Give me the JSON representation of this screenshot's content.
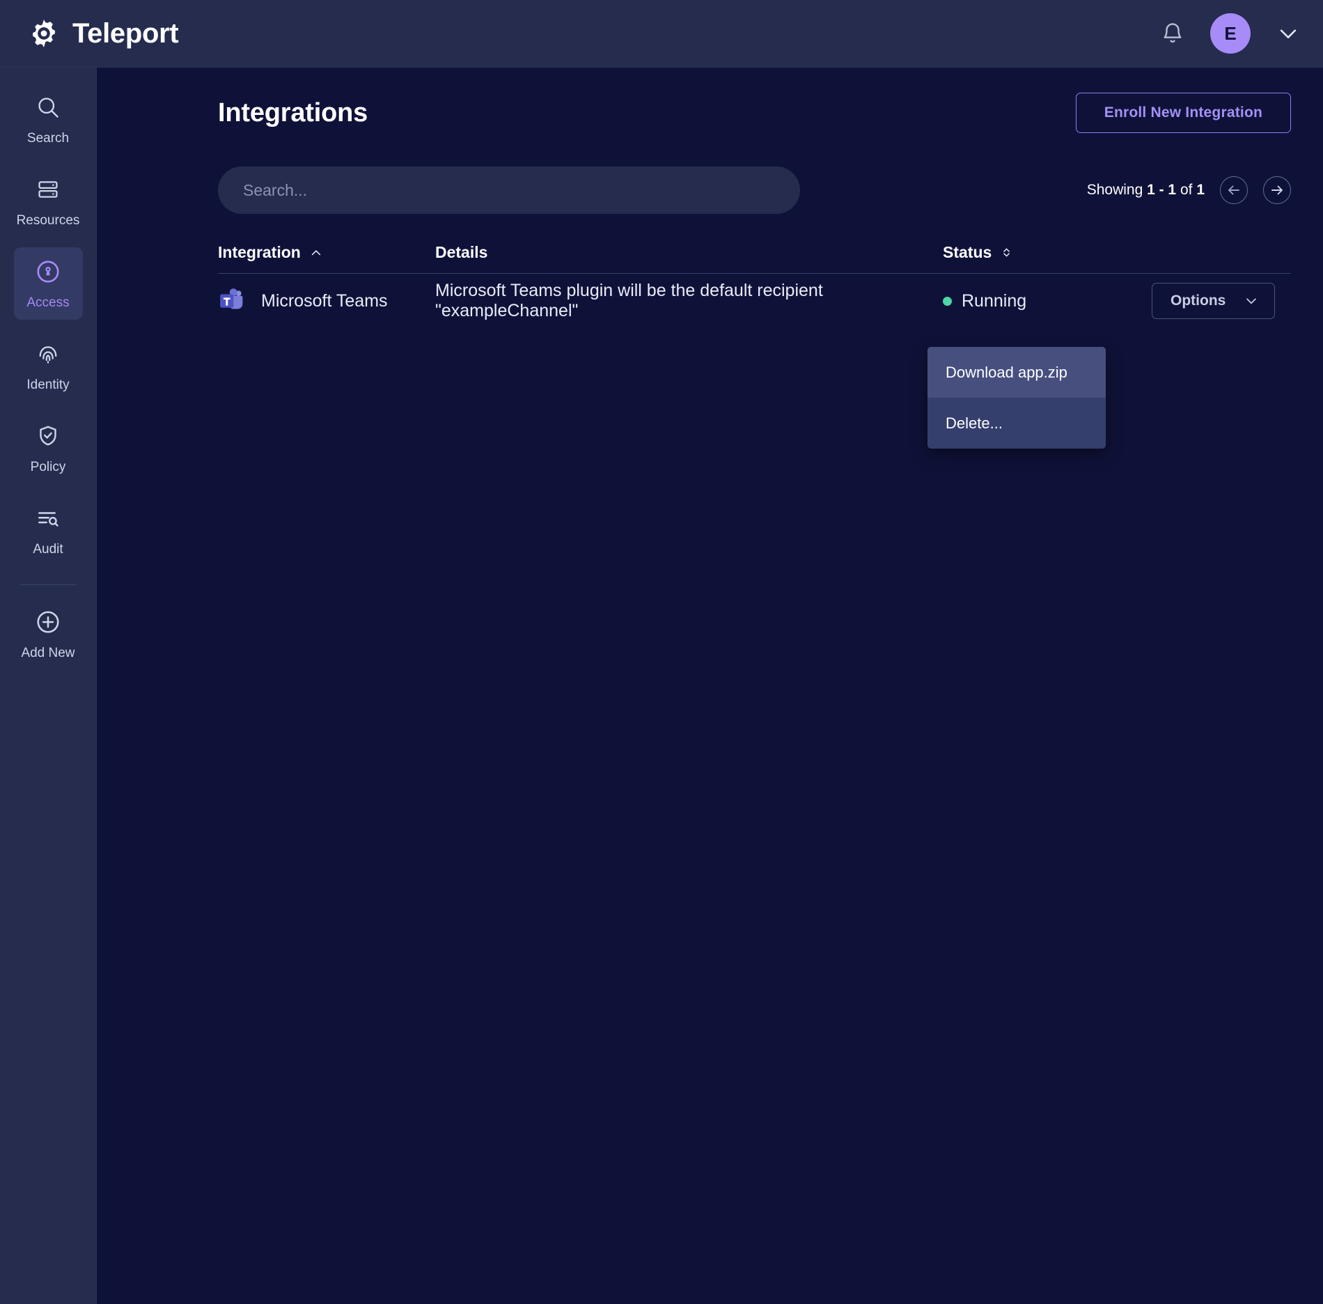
{
  "brand": {
    "name": "Teleport",
    "logo_icon": "gear-icon"
  },
  "topbar": {
    "notifications_icon": "bell-icon",
    "avatar_initial": "E",
    "account_chevron_icon": "chevron-down-icon"
  },
  "sidebar": {
    "items": [
      {
        "label": "Search",
        "icon": "search-icon",
        "active": false
      },
      {
        "label": "Resources",
        "icon": "server-icon",
        "active": false
      },
      {
        "label": "Access",
        "icon": "lock-circle-icon",
        "active": true
      },
      {
        "label": "Identity",
        "icon": "fingerprint-icon",
        "active": false
      },
      {
        "label": "Policy",
        "icon": "shield-check-icon",
        "active": false
      },
      {
        "label": "Audit",
        "icon": "list-search-icon",
        "active": false
      }
    ],
    "footer_item": {
      "label": "Add New",
      "icon": "plus-circle-icon"
    }
  },
  "page": {
    "title": "Integrations",
    "enroll_button": "Enroll New Integration"
  },
  "search": {
    "placeholder": "Search...",
    "value": ""
  },
  "pagination": {
    "prefix": "Showing ",
    "range": "1 - 1",
    "middle": " of ",
    "total": "1",
    "prev_icon": "arrow-left-icon",
    "next_icon": "arrow-right-icon"
  },
  "table": {
    "columns": [
      {
        "label": "Integration",
        "sort": "asc",
        "sort_icon": "chevron-up-icon"
      },
      {
        "label": "Details",
        "sort": "none",
        "sort_icon": ""
      },
      {
        "label": "Status",
        "sort": "none",
        "sort_icon": "chevron-updown-icon"
      }
    ],
    "rows": [
      {
        "integration": "Microsoft Teams",
        "integration_icon": "microsoft-teams-icon",
        "details": "Microsoft Teams plugin will be the default recipient \"exampleChannel\"",
        "status": "Running",
        "status_color": "#4ed6a4",
        "options_label": "Options",
        "options_icon": "chevron-down-icon"
      }
    ]
  },
  "options_menu": {
    "items": [
      {
        "label": "Download app.zip",
        "highlighted": true
      },
      {
        "label": "Delete...",
        "highlighted": false
      }
    ]
  },
  "colors": {
    "accent": "#a788f7",
    "sidebar_bg": "#252c4e",
    "main_bg": "#0f1238",
    "menu_bg": "#353f6e",
    "menu_hover": "#474f7f",
    "status_running": "#4ed6a4"
  }
}
